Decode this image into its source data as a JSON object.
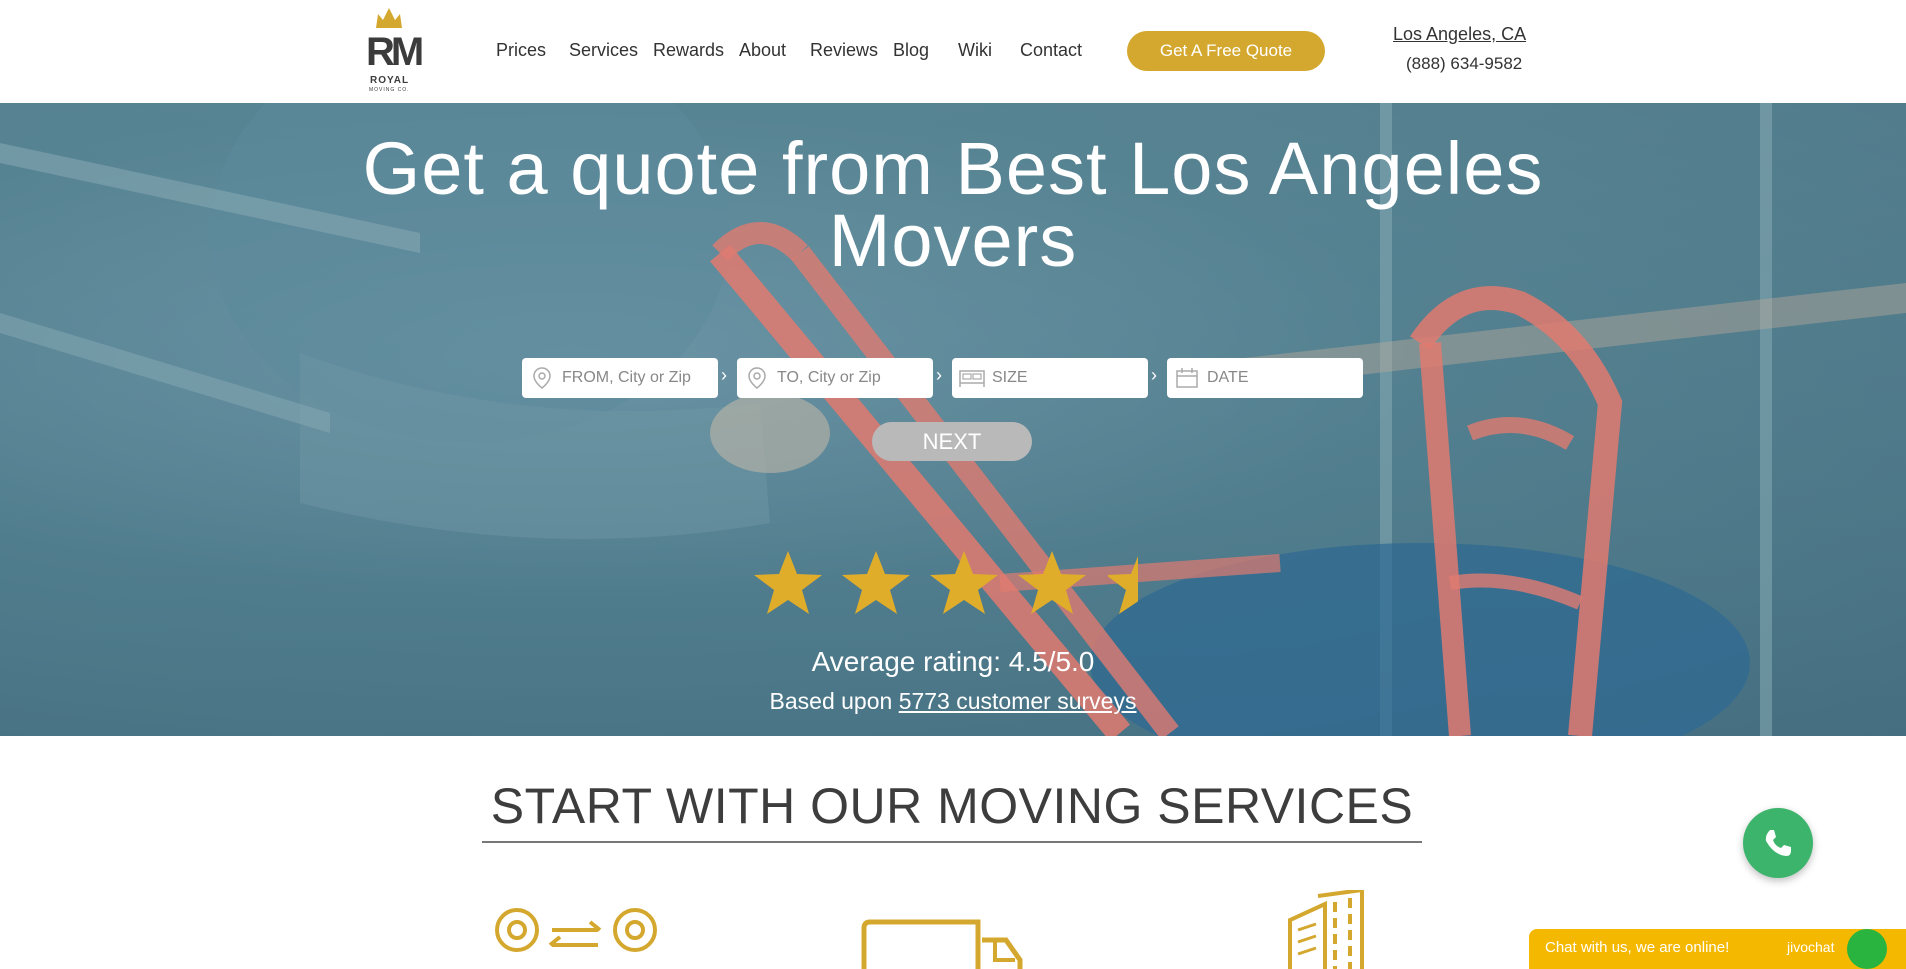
{
  "brand": {
    "logo_initials": "RM",
    "logo_name": "ROYAL",
    "logo_sub": "MOVING CO."
  },
  "nav": {
    "items": [
      {
        "label": "Prices"
      },
      {
        "label": "Services"
      },
      {
        "label": "Rewards"
      },
      {
        "label": "About"
      },
      {
        "label": "Reviews"
      },
      {
        "label": "Blog"
      },
      {
        "label": "Wiki"
      },
      {
        "label": "Contact"
      }
    ],
    "quote_button": "Get A Free Quote",
    "location": "Los Angeles, CA",
    "phone": "(888) 634-9582"
  },
  "hero": {
    "title": "Get a quote from Best Los Angeles Movers",
    "form": {
      "from_placeholder": "FROM, City or Zip",
      "to_placeholder": "TO, City or Zip",
      "size_placeholder": "SIZE",
      "date_placeholder": "DATE",
      "separator": "›",
      "next_label": "NEXT"
    },
    "rating": {
      "stars": 4.5,
      "max": 5,
      "text": "Average rating: 4.5/5.0",
      "based_prefix": "Based upon ",
      "surveys_link": "5773 customer surveys"
    }
  },
  "services": {
    "title": "START WITH OUR MOVING SERVICES"
  },
  "chat": {
    "message": "Chat with us, we are online!",
    "brand": "jivochat"
  },
  "colors": {
    "accent": "#d4a82e",
    "call": "#3cb46c",
    "chat": "#f5b800"
  }
}
